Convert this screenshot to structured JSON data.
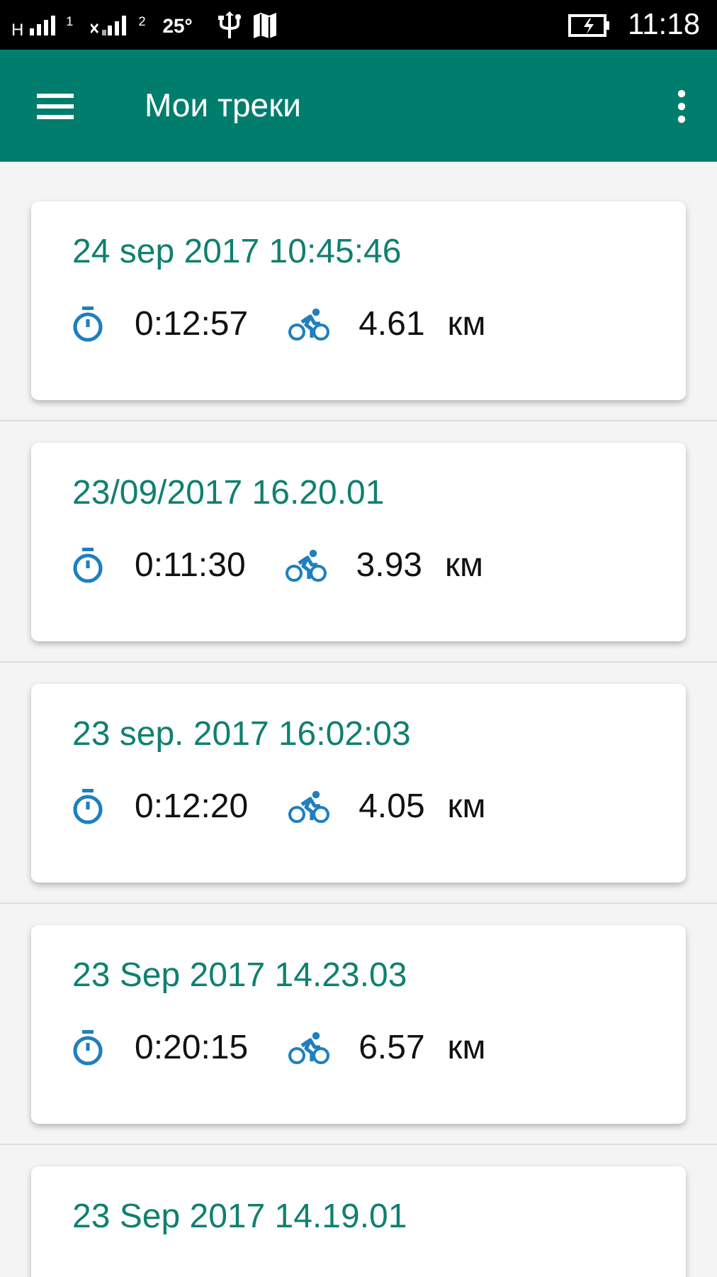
{
  "status_bar": {
    "network": "H",
    "sim_1": "1",
    "sim_2": "2",
    "temperature": "25°",
    "time": "11:18"
  },
  "toolbar": {
    "title": "Мои треки"
  },
  "tracks": [
    {
      "date": "24 sep 2017 10:45:46",
      "duration": "0:12:57",
      "distance": "4.61",
      "unit": "км"
    },
    {
      "date": "23/09/2017 16.20.01",
      "duration": "0:11:30",
      "distance": "3.93",
      "unit": "км"
    },
    {
      "date": "23 sep. 2017 16:02:03",
      "duration": "0:12:20",
      "distance": "4.05",
      "unit": "км"
    },
    {
      "date": "23 Sep 2017 14.23.03",
      "duration": "0:20:15",
      "distance": "6.57",
      "unit": "км"
    },
    {
      "date": "23 Sep 2017 14.19.01"
    }
  ]
}
